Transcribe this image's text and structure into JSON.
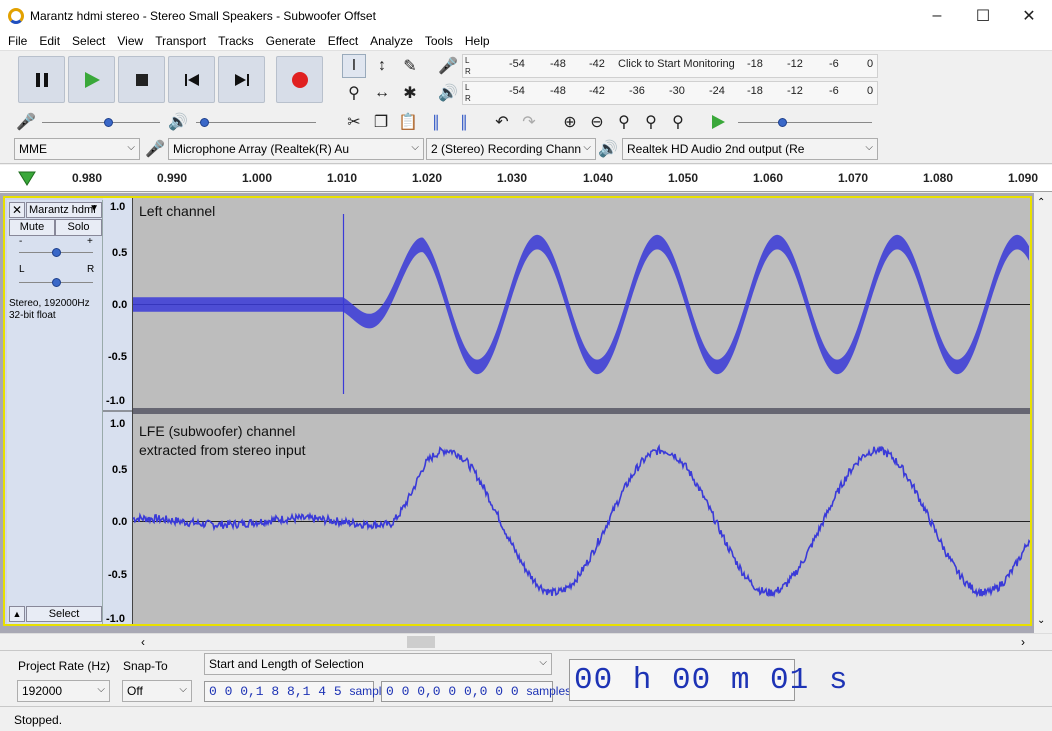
{
  "window": {
    "title": "Marantz hdmi stereo - Stereo Small Speakers - Subwoofer Offset"
  },
  "menu": [
    "File",
    "Edit",
    "Select",
    "View",
    "Transport",
    "Tracks",
    "Generate",
    "Effect",
    "Analyze",
    "Tools",
    "Help"
  ],
  "meters": {
    "record_ticks": [
      "-54",
      "-48",
      "-42",
      "Click to Start Monitoring",
      "-18",
      "-12",
      "-6",
      "0"
    ],
    "play_ticks": [
      "-54",
      "-48",
      "-42",
      "-36",
      "-30",
      "-24",
      "-18",
      "-12",
      "-6",
      "0"
    ],
    "lr": {
      "l": "L",
      "r": "R"
    }
  },
  "device": {
    "host": "MME",
    "input": "Microphone Array (Realtek(R) Au",
    "channels": "2 (Stereo) Recording Chann",
    "output": "Realtek HD Audio 2nd output (Re"
  },
  "timeline": {
    "ticks": [
      "0.980",
      "0.990",
      "1.000",
      "1.010",
      "1.020",
      "1.030",
      "1.040",
      "1.050",
      "1.060",
      "1.070",
      "1.080",
      "1.090"
    ]
  },
  "track": {
    "name": "Marantz hdmi",
    "mute": "Mute",
    "solo": "Solo",
    "gain_minus": "-",
    "gain_plus": "+",
    "pan_l": "L",
    "pan_r": "R",
    "info_line1": "Stereo, 192000Hz",
    "info_line2": "32-bit float",
    "select": "Select",
    "channel1_label": "Left channel",
    "channel2_label_line1": "LFE (subwoofer) channel",
    "channel2_label_line2": "extracted from stereo input",
    "scale": [
      "1.0",
      "0.5",
      "0.0",
      "-0.5",
      "-1.0"
    ]
  },
  "selection_toolbar": {
    "rate_label": "Project Rate (Hz)",
    "rate_value": "192000",
    "snap_label": "Snap-To",
    "snap_value": "Off",
    "mode": "Start and Length of Selection",
    "start": "0 0 0,1 8 8,1 4 5",
    "length": "0 0 0,0 0 0,0 0 0",
    "unit": "samples",
    "time": "00 h 00 m 01 s"
  },
  "status": {
    "text": "Stopped."
  },
  "colors": {
    "waveform": "#3a3ad8",
    "track_bg": "#bdbdbd",
    "selection_border": "#e8e000"
  }
}
